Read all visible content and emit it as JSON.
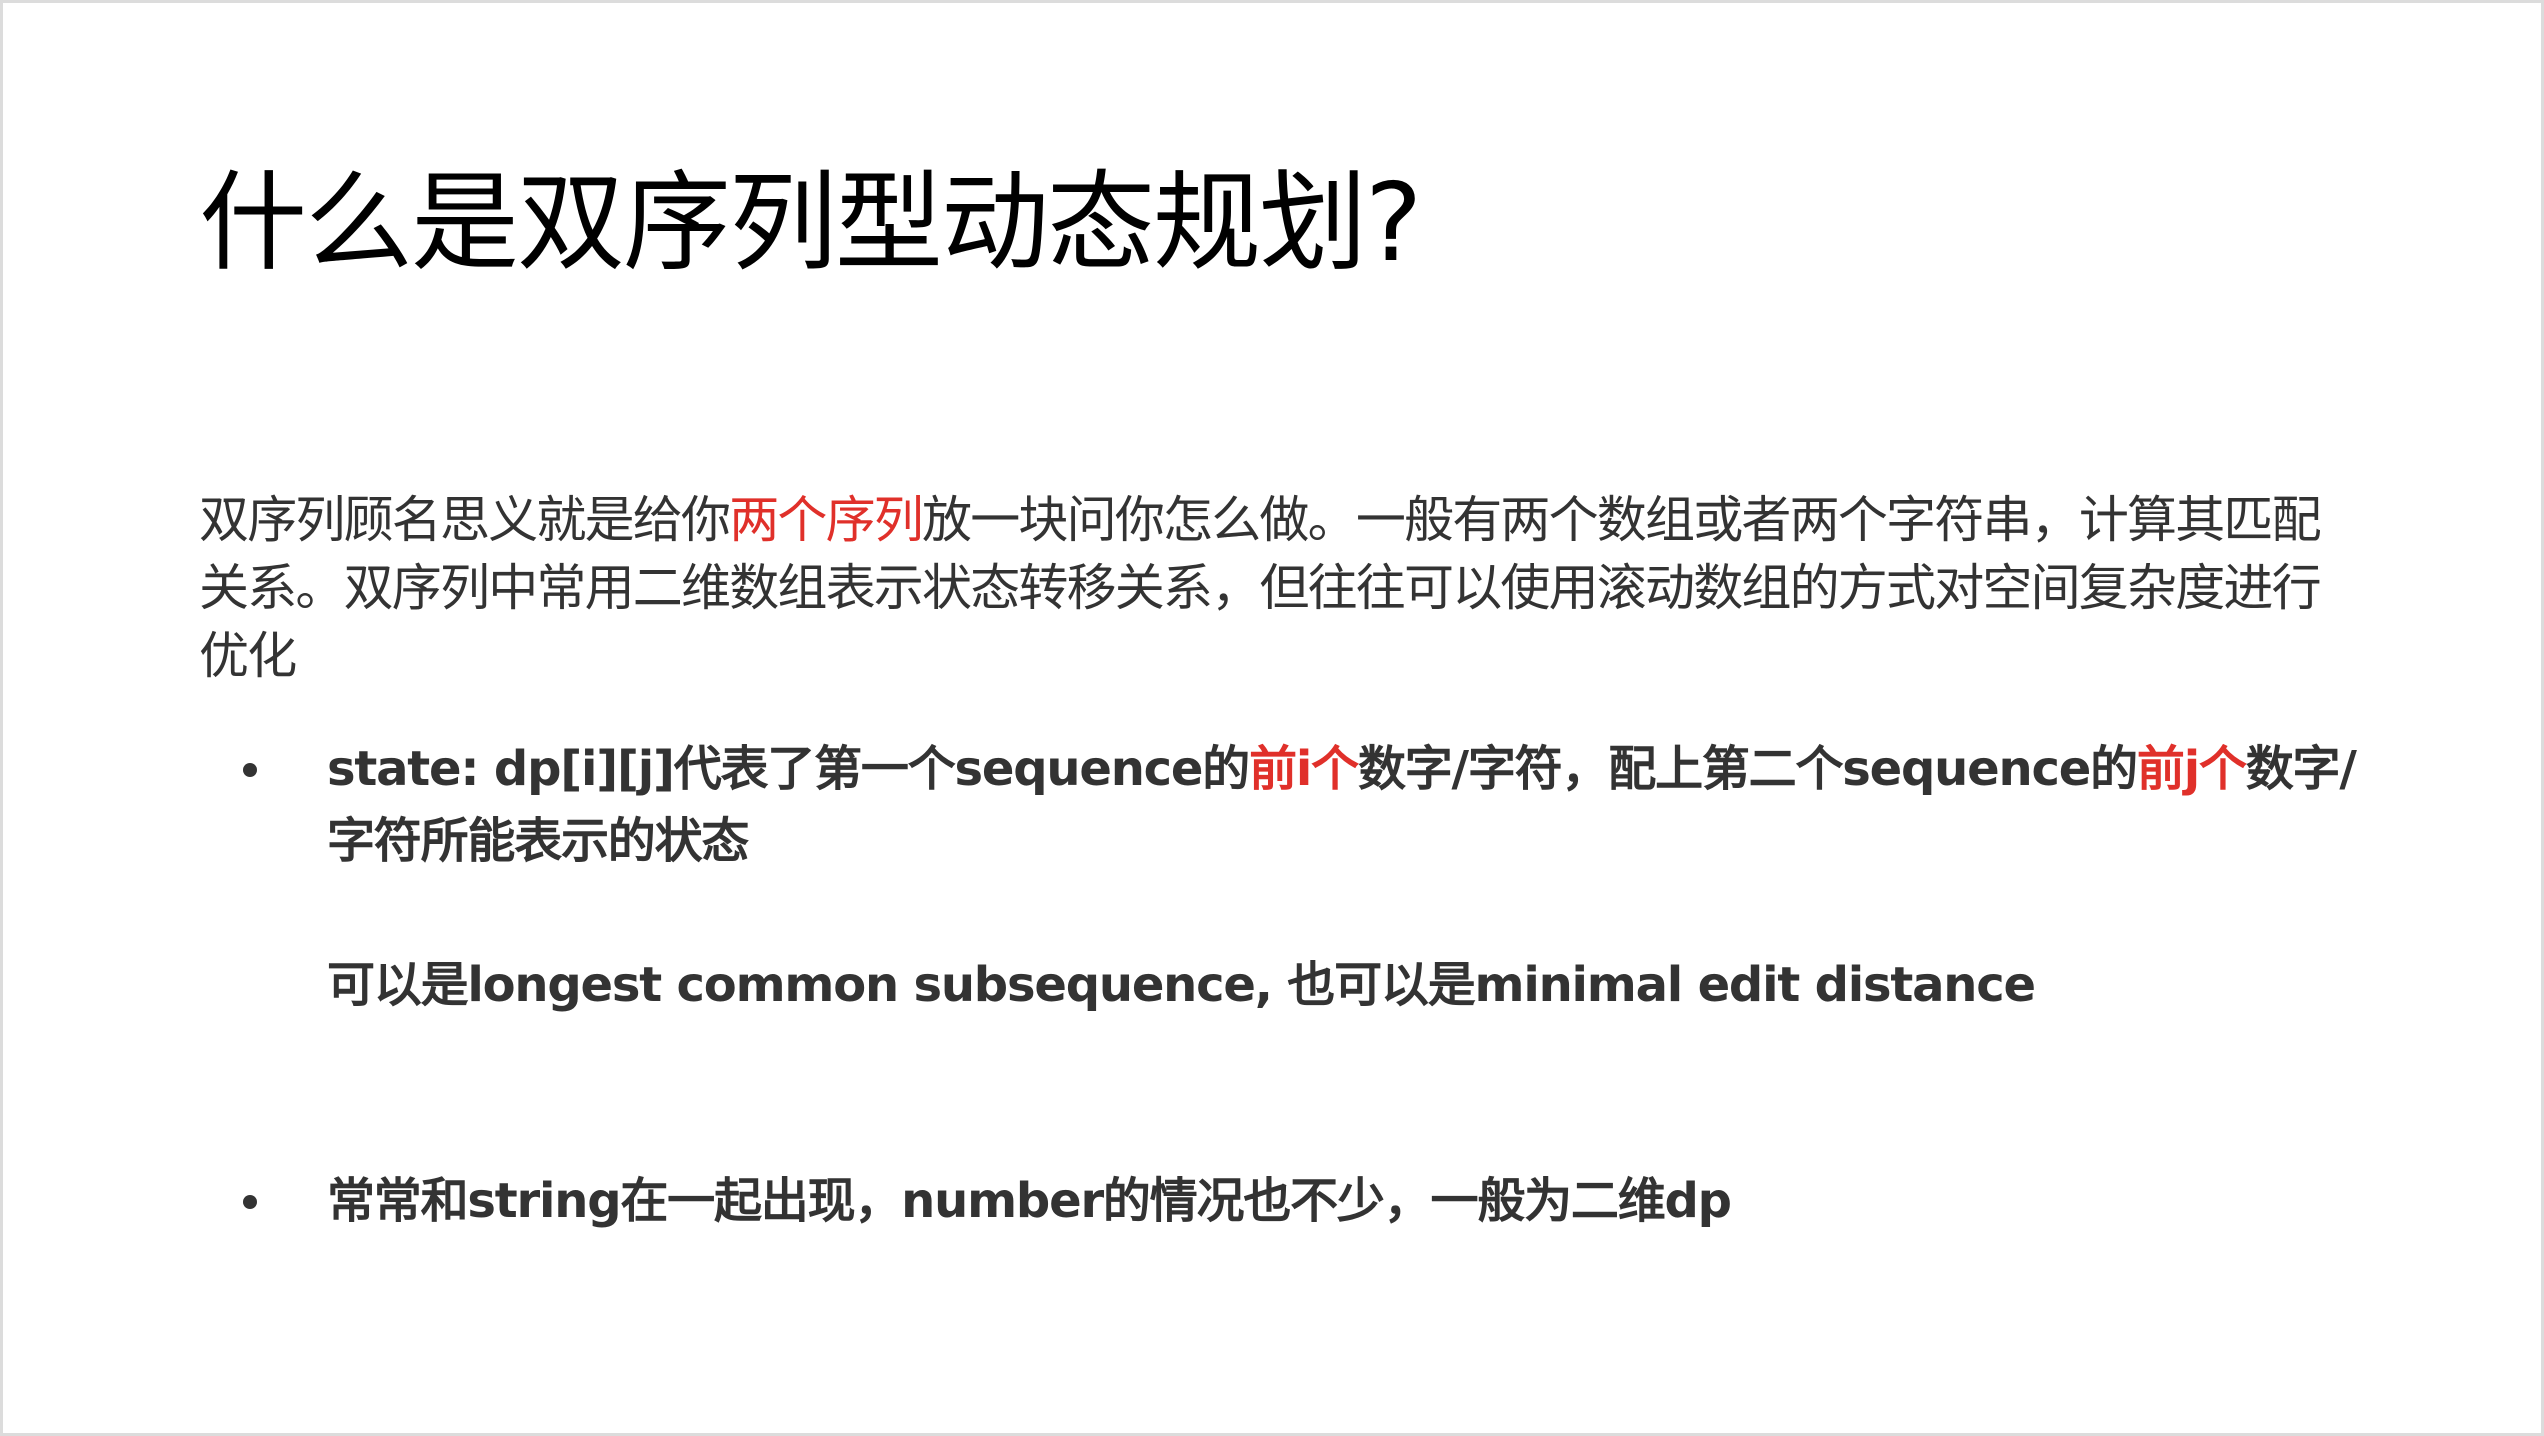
{
  "slide": {
    "title": "什么是双序列型动态规划?",
    "intro": {
      "part1": "双序列顾名思义就是给你",
      "highlight": "两个序列",
      "part2": "放一块问你怎么做。一般有两个数组或者两个字符串，计算其匹配关系。双序列中常用二维数组表示状态转移关系，但往往可以使用滚动数组的方式对空间复杂度进行优化"
    },
    "bullets": [
      {
        "seg1": "state: dp[i][j]代表了第一个sequence的",
        "hl1": "前i个",
        "seg2": "数字/字符，配上第二个sequence的",
        "hl2": "前j个",
        "seg3": "数字/字符所能表示的状态",
        "subline": "可以是longest common subsequence, 也可以是minimal edit distance"
      },
      {
        "text": "常常和string在一起出现，number的情况也不少，一般为二维dp"
      }
    ],
    "colors": {
      "text": "#333333",
      "title": "#000000",
      "highlight": "#e0302a"
    }
  }
}
